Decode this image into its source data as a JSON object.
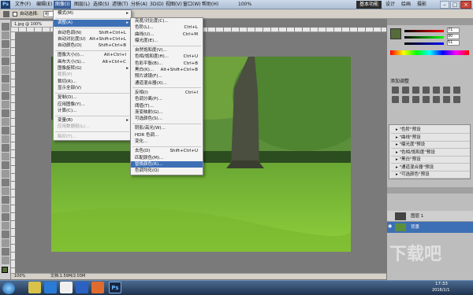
{
  "app": {
    "logo": "Ps"
  },
  "menubar": {
    "items": [
      "文件(F)",
      "编辑(E)",
      "图像(I)",
      "图层(L)",
      "选择(S)",
      "滤镜(T)",
      "分析(A)",
      "3D(D)",
      "视图(V)",
      "窗口(W)",
      "帮助(H)"
    ],
    "zoom": "100%",
    "workspaces": [
      "基本功能",
      "设计",
      "绘画",
      "摄影"
    ]
  },
  "options": {
    "auto_select_label": "自动选择:",
    "auto_select_value": "组"
  },
  "document": {
    "tab": "1.jpg @ 100% (RGB/8)",
    "status_zoom": "100%",
    "status_doc": "文档:1.59M/2.03M"
  },
  "image_menu": {
    "items": [
      {
        "label": "模式(M)",
        "shortcut": "",
        "arrow": true
      },
      {
        "sep": true
      },
      {
        "label": "调整(A)",
        "shortcut": "",
        "arrow": true,
        "highlight": true
      },
      {
        "sep": true
      },
      {
        "label": "自动色调(N)",
        "shortcut": "Shift+Ctrl+L"
      },
      {
        "label": "自动对比度(U)",
        "shortcut": "Alt+Shift+Ctrl+L"
      },
      {
        "label": "自动颜色(O)",
        "shortcut": "Shift+Ctrl+B"
      },
      {
        "sep": true
      },
      {
        "label": "图像大小(I)...",
        "shortcut": "Alt+Ctrl+I"
      },
      {
        "label": "画布大小(S)...",
        "shortcut": "Alt+Ctrl+C"
      },
      {
        "label": "图像旋转(G)",
        "shortcut": "",
        "arrow": true
      },
      {
        "label": "裁剪(P)",
        "shortcut": "",
        "disabled": true
      },
      {
        "label": "裁切(R)...",
        "shortcut": ""
      },
      {
        "label": "显示全部(V)",
        "shortcut": ""
      },
      {
        "sep": true
      },
      {
        "label": "复制(D)...",
        "shortcut": ""
      },
      {
        "label": "应用图像(Y)...",
        "shortcut": ""
      },
      {
        "label": "计算(C)...",
        "shortcut": ""
      },
      {
        "sep": true
      },
      {
        "label": "变量(B)",
        "shortcut": "",
        "arrow": true
      },
      {
        "label": "应用数据组(L)...",
        "shortcut": "",
        "disabled": true
      },
      {
        "sep": true
      },
      {
        "label": "陷印(T)...",
        "shortcut": "",
        "disabled": true
      }
    ]
  },
  "adjust_menu": {
    "items": [
      {
        "label": "亮度/对比度(C)...",
        "shortcut": ""
      },
      {
        "label": "色阶(L)...",
        "shortcut": "Ctrl+L"
      },
      {
        "label": "曲线(U)...",
        "shortcut": "Ctrl+M"
      },
      {
        "label": "曝光度(E)...",
        "shortcut": ""
      },
      {
        "sep": true
      },
      {
        "label": "自然饱和度(V)...",
        "shortcut": ""
      },
      {
        "label": "色相/饱和度(H)...",
        "shortcut": "Ctrl+U"
      },
      {
        "label": "色彩平衡(B)...",
        "shortcut": "Ctrl+B"
      },
      {
        "label": "黑白(K)...",
        "shortcut": "Alt+Shift+Ctrl+B"
      },
      {
        "label": "照片滤镜(F)...",
        "shortcut": ""
      },
      {
        "label": "通道混合器(X)...",
        "shortcut": ""
      },
      {
        "sep": true
      },
      {
        "label": "反相(I)",
        "shortcut": "Ctrl+I"
      },
      {
        "label": "色调分离(P)...",
        "shortcut": ""
      },
      {
        "label": "阈值(T)...",
        "shortcut": ""
      },
      {
        "label": "渐变映射(G)...",
        "shortcut": ""
      },
      {
        "label": "可选颜色(S)...",
        "shortcut": ""
      },
      {
        "sep": true
      },
      {
        "label": "阴影/高光(W)...",
        "shortcut": ""
      },
      {
        "label": "HDR 色调...",
        "shortcut": ""
      },
      {
        "label": "变化...",
        "shortcut": ""
      },
      {
        "sep": true
      },
      {
        "label": "去色(D)",
        "shortcut": "Shift+Ctrl+U"
      },
      {
        "label": "匹配颜色(M)...",
        "shortcut": ""
      },
      {
        "label": "替换颜色(R)...",
        "shortcut": "",
        "highlight": true
      },
      {
        "label": "色调均化(Q)",
        "shortcut": ""
      }
    ]
  },
  "panels": {
    "color_values": [
      "71",
      "90",
      "51"
    ],
    "adjust_title": "添加调整",
    "presets": [
      "\"色阶\"预设",
      "\"曲线\"预设",
      "\"曝光度\"预设",
      "\"色相/饱和度\"预设",
      "\"黑白\"预设",
      "\"通道混合器\"预设",
      "\"可选颜色\"预设"
    ],
    "layers": [
      {
        "name": "图层 1"
      },
      {
        "name": "背景",
        "selected": true
      }
    ]
  },
  "taskbar": {
    "time": "17:33",
    "date": "2016/1/1"
  },
  "watermark": "下载吧",
  "colors": {
    "highlight": "#3d6fb5",
    "menu_bg": "#f3f3f3",
    "panel_bg": "#bdbdbd"
  }
}
